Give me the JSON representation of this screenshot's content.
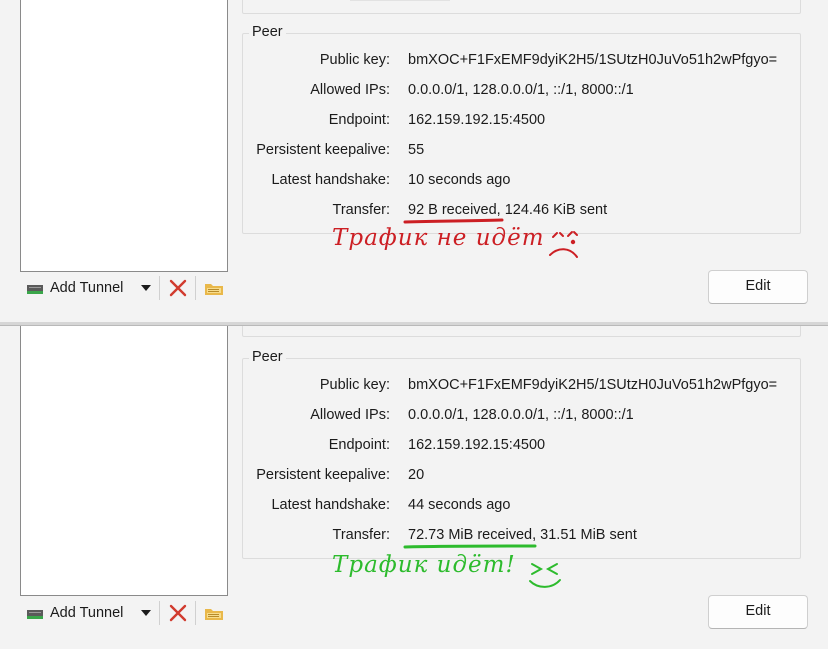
{
  "panels": [
    {
      "id": "top",
      "peer": {
        "section_title": "Peer",
        "fields": [
          {
            "label": "Public key:",
            "value": "bmXOC+F1FxEMF9dyiK2H5/1SUtzH0JuVo51h2wPfgyo="
          },
          {
            "label": "Allowed IPs:",
            "value": "0.0.0.0/1, 128.0.0.0/1, ::/1, 8000::/1"
          },
          {
            "label": "Endpoint:",
            "value": "162.159.192.15:4500"
          },
          {
            "label": "Persistent keepalive:",
            "value": "55"
          },
          {
            "label": "Latest handshake:",
            "value": "10 seconds ago"
          },
          {
            "label": "Transfer:",
            "value_received": "92 B received",
            "value_rest": ", 124.46 KiB sent"
          }
        ]
      },
      "annotation": {
        "text": "Трафик не идёт",
        "color": "#cc1f24"
      }
    },
    {
      "id": "bottom",
      "peer": {
        "section_title": "Peer",
        "fields": [
          {
            "label": "Public key:",
            "value": "bmXOC+F1FxEMF9dyiK2H5/1SUtzH0JuVo51h2wPfgyo="
          },
          {
            "label": "Allowed IPs:",
            "value": "0.0.0.0/1, 128.0.0.0/1, ::/1, 8000::/1"
          },
          {
            "label": "Endpoint:",
            "value": "162.159.192.15:4500"
          },
          {
            "label": "Persistent keepalive:",
            "value": "20"
          },
          {
            "label": "Latest handshake:",
            "value": "44 seconds ago"
          },
          {
            "label": "Transfer:",
            "value_received": "72.73 MiB received",
            "value_rest": ", 31.51 MiB sent"
          }
        ]
      },
      "annotation": {
        "text": "Трафик идёт!",
        "color": "#2dbb2d"
      }
    }
  ],
  "toolbar": {
    "add_tunnel_label": "Add Tunnel",
    "icons": {
      "add": "network-adapter-icon",
      "dropdown": "triangle-down-icon",
      "delete": "red-x-icon",
      "import": "folder-icon"
    }
  },
  "edit_label": "Edit",
  "colors": {
    "window_bg": "#f3f3f3",
    "delete_red": "#d13b2e",
    "folder_yellow": "#e9b84a",
    "underline_red": "#cc1f24",
    "underline_green": "#2dbb2d"
  }
}
